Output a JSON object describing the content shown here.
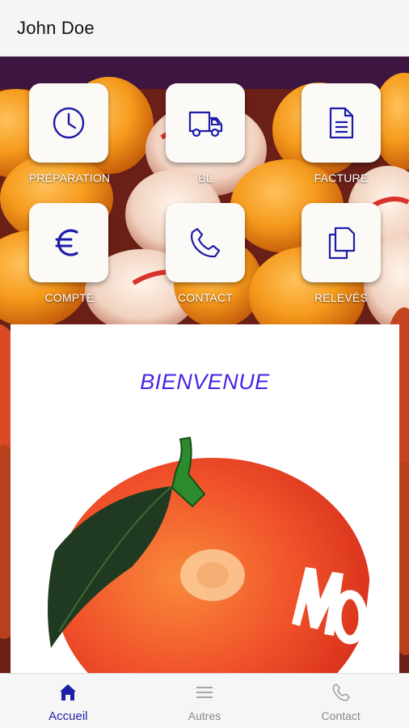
{
  "app_bar": {
    "title": "John Doe"
  },
  "tiles": [
    {
      "label": "PRÉPARATION",
      "icon": "clock-icon"
    },
    {
      "label": "BL",
      "icon": "truck-icon"
    },
    {
      "label": "FACTURE",
      "icon": "document-icon"
    },
    {
      "label": "COMPTE",
      "icon": "euro-icon"
    },
    {
      "label": "CONTACT",
      "icon": "phone-icon"
    },
    {
      "label": "RELEVÉS",
      "icon": "copy-icon"
    }
  ],
  "welcome": {
    "title": "BIENVENUE",
    "brand_text": "MOI"
  },
  "bottom_nav": [
    {
      "label": "Accueil",
      "icon": "home-icon",
      "active": true
    },
    {
      "label": "Autres",
      "icon": "menu-icon",
      "active": false
    },
    {
      "label": "Contact",
      "icon": "phone-icon",
      "active": false
    }
  ],
  "colors": {
    "icon_blue": "#1c1ca8",
    "welcome_purple": "#4a23e3",
    "nav_active": "#1f1fa6",
    "nav_inactive": "#8a8a8a"
  }
}
